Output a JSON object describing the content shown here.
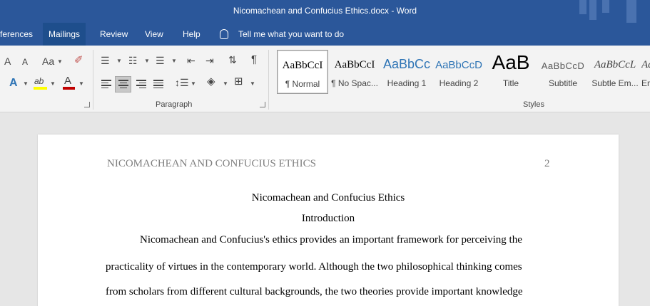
{
  "window": {
    "title": "Nicomachean and Confucius Ethics.docx  -  Word"
  },
  "tabs": [
    {
      "label": "ferences"
    },
    {
      "label": "Mailings"
    },
    {
      "label": "Review"
    },
    {
      "label": "View"
    },
    {
      "label": "Help"
    }
  ],
  "tellme": {
    "text": "Tell me what you want to do"
  },
  "ribbon": {
    "font_group": {
      "grow_glyph": "A",
      "shrink_glyph": "A",
      "case_glyph": "Aa",
      "text_effects_glyph": "A",
      "highlight_glyph": "ab",
      "font_color_glyph": "A",
      "font_color": "#c00000",
      "highlight_color": "#ffff00"
    },
    "paragraph_label": "Paragraph",
    "pilcrow_glyph": "¶",
    "styles_label": "Styles",
    "styles": [
      {
        "preview": "AaBbCcI",
        "name": "¶ Normal",
        "color": "#000000"
      },
      {
        "preview": "AaBbCcI",
        "name": "¶ No Spac...",
        "color": "#000000"
      },
      {
        "preview": "AaBbCc",
        "name": "Heading 1",
        "color": "#2e74b5"
      },
      {
        "preview": "AaBbCcD",
        "name": "Heading 2",
        "color": "#2e74b5"
      },
      {
        "preview": "AaB",
        "name": "Title",
        "color": "#000000"
      },
      {
        "preview": "AaBbCcD",
        "name": "Subtitle",
        "color": "#595959"
      },
      {
        "preview": "AaBbCcL",
        "name": "Subtle Em...",
        "color": "#404040"
      },
      {
        "preview": "Aa",
        "name": "Em",
        "color": "#404040"
      }
    ]
  },
  "document": {
    "header_text": "NICOMACHEAN AND CONFUCIUS ETHICS",
    "page_number": "2",
    "title": "Nicomachean and Confucius Ethics",
    "section_heading": "Introduction",
    "paragraph_lines": [
      "Nicomachean and Confucius's ethics provides an important framework for perceiving the",
      "practicality of virtues in the contemporary world. Although the two philosophical thinking comes",
      "from scholars from different cultural backgrounds, the two theories provide important knowledge"
    ]
  }
}
